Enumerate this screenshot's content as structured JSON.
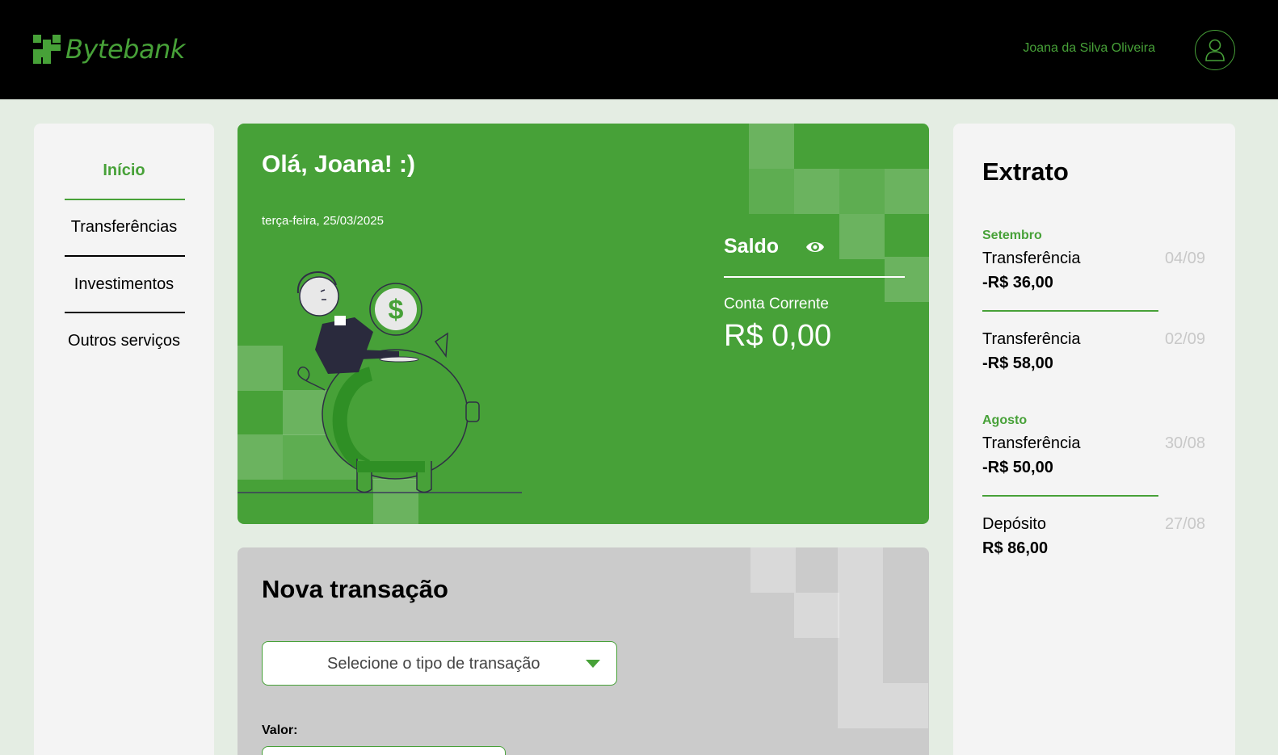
{
  "header": {
    "brand": "Bytebank",
    "user_name": "Joana da Silva Oliveira",
    "avatar_icon": "user-icon"
  },
  "sidebar": {
    "items": [
      {
        "label": "Início",
        "active": true
      },
      {
        "label": "Transferências",
        "active": false
      },
      {
        "label": "Investimentos",
        "active": false
      },
      {
        "label": "Outros serviços",
        "active": false
      }
    ]
  },
  "balance": {
    "greeting": "Olá, Joana! :)",
    "date": "terça-feira, 25/03/2025",
    "label": "Saldo",
    "visibility_icon": "eye-icon",
    "account_type": "Conta Corrente",
    "amount": "R$ 0,00"
  },
  "new_transaction": {
    "title": "Nova transação",
    "select_placeholder": "Selecione o tipo de transação",
    "value_label": "Valor:"
  },
  "statement": {
    "title": "Extrato",
    "groups": [
      {
        "month": "Setembro",
        "entries": [
          {
            "type": "Transferência",
            "date": "04/09",
            "amount": "-R$ 36,00"
          },
          {
            "type": "Transferência",
            "date": "02/09",
            "amount": "-R$ 58,00"
          }
        ]
      },
      {
        "month": "Agosto",
        "entries": [
          {
            "type": "Transferência",
            "date": "30/08",
            "amount": "-R$ 50,00"
          },
          {
            "type": "Depósito",
            "date": "27/08",
            "amount": "R$ 86,00"
          }
        ]
      }
    ]
  },
  "colors": {
    "brand_green": "#47a138",
    "header_bg": "#000000",
    "page_bg": "#e4ede3",
    "panel_bg": "#f4f4f4",
    "tx_card_bg": "#cbcbcb"
  }
}
